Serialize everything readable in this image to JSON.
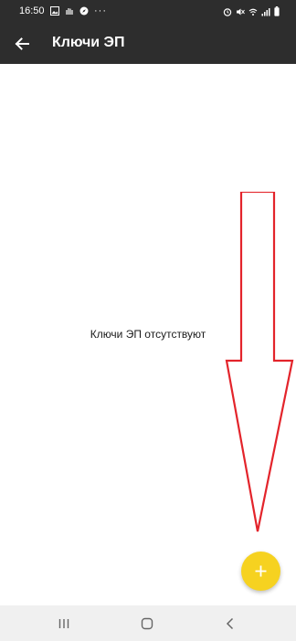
{
  "status_bar": {
    "time": "16:50",
    "more_dots": "···",
    "left_icons": [
      "image-icon",
      "vpn-hand-icon",
      "compass-icon"
    ],
    "right_icons": [
      "alarm-icon",
      "mute-icon",
      "wifi-icon",
      "signal-icon",
      "battery-icon"
    ]
  },
  "app_bar": {
    "title": "Ключи ЭП",
    "back_icon": "arrow-back-icon"
  },
  "content": {
    "empty_message": "Ключи ЭП отсутствуют"
  },
  "fab": {
    "icon": "plus-icon",
    "color": "#F6D220"
  },
  "annotation": {
    "arrow_color": "#E3242B"
  },
  "nav_bar": {
    "icons": [
      "recent-apps-icon",
      "home-icon",
      "back-icon"
    ]
  },
  "colors": {
    "app_bar": "#2D2D2D",
    "nav_bar": "#F0F0F0"
  }
}
